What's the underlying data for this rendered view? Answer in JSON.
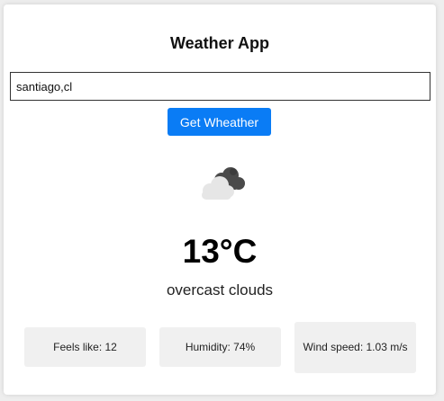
{
  "app": {
    "title": "Weather App"
  },
  "search": {
    "value": "santiago,cl",
    "button_label": "Get Wheather"
  },
  "weather": {
    "icon": "overcast-clouds-icon",
    "temperature": "13°C",
    "description": "overcast clouds"
  },
  "stats": {
    "feels_like": "Feels like: 12",
    "humidity": "Humidity: 74%",
    "wind_speed": "Wind speed: 1.03 m/s"
  },
  "colors": {
    "accent": "#0a7cf5",
    "card_background": "#ffffff",
    "stat_background": "#f0f0f0",
    "page_background": "#eeeeee"
  }
}
